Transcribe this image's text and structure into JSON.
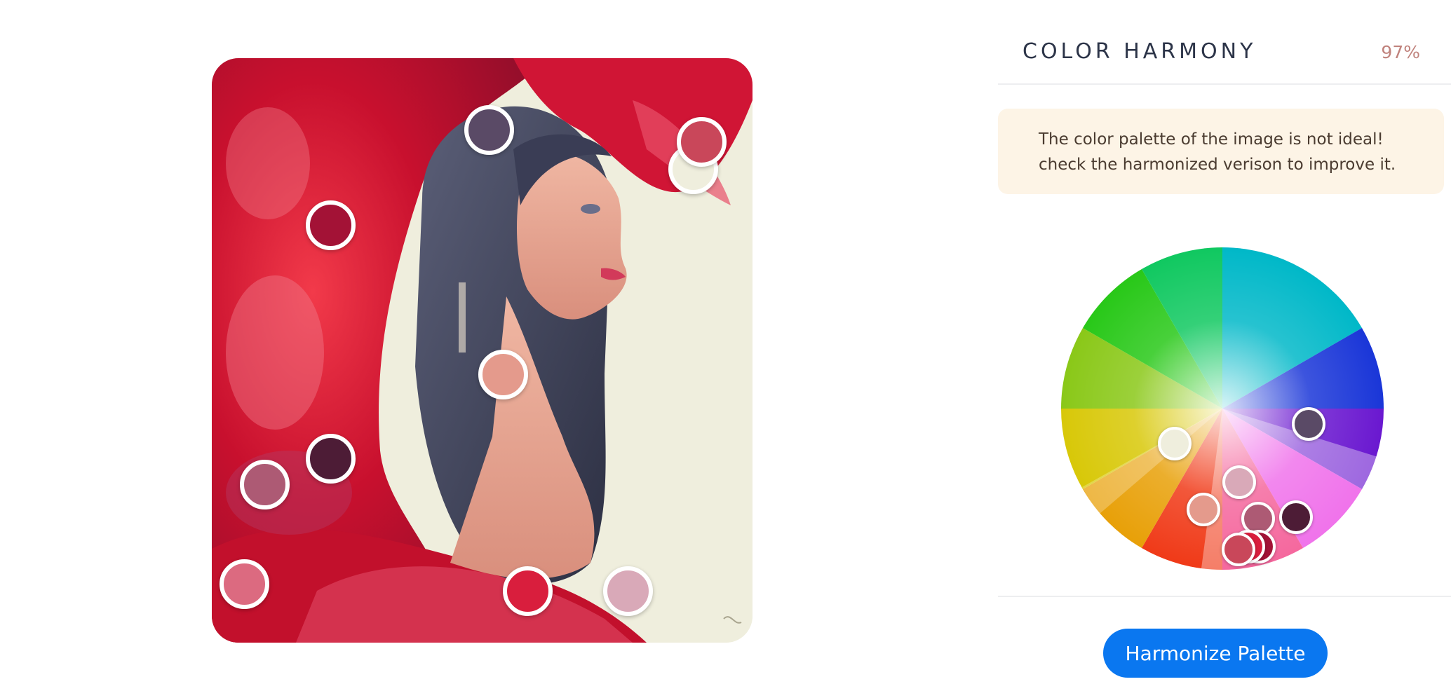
{
  "panel": {
    "title": "COLOR HARMONY",
    "score": "97%",
    "warning": "The color palette of the image is not ideal! check the harmonized verison to improve it.",
    "button_label": "Harmonize Palette"
  },
  "image_swatches": [
    {
      "name": "swatch-dark-plum",
      "color": "#5a4a66"
    },
    {
      "name": "swatch-rose-red",
      "color": "#c9475a"
    },
    {
      "name": "swatch-cream",
      "color": "#efeedd"
    },
    {
      "name": "swatch-crimson",
      "color": "#a31236"
    },
    {
      "name": "swatch-peach",
      "color": "#e49a8c"
    },
    {
      "name": "swatch-wine",
      "color": "#4d1c36"
    },
    {
      "name": "swatch-mauve",
      "color": "#ad5a74"
    },
    {
      "name": "swatch-pink",
      "color": "#dc6a80"
    },
    {
      "name": "swatch-red",
      "color": "#d91e3d"
    },
    {
      "name": "swatch-light-pink",
      "color": "#d9a9b8"
    }
  ],
  "wheel_swatches": [
    {
      "name": "wheel-dot-plum",
      "color": "#5a4a66"
    },
    {
      "name": "wheel-dot-cream",
      "color": "#efeedd"
    },
    {
      "name": "wheel-dot-light-pink",
      "color": "#d9a9b8"
    },
    {
      "name": "wheel-dot-peach",
      "color": "#e49a8c"
    },
    {
      "name": "wheel-dot-mauve",
      "color": "#ad5a74"
    },
    {
      "name": "wheel-dot-wine",
      "color": "#4d1c36"
    },
    {
      "name": "wheel-dot-crimson",
      "color": "#a31236"
    },
    {
      "name": "wheel-dot-red",
      "color": "#d91e3d"
    },
    {
      "name": "wheel-dot-rose",
      "color": "#c9475a"
    }
  ]
}
